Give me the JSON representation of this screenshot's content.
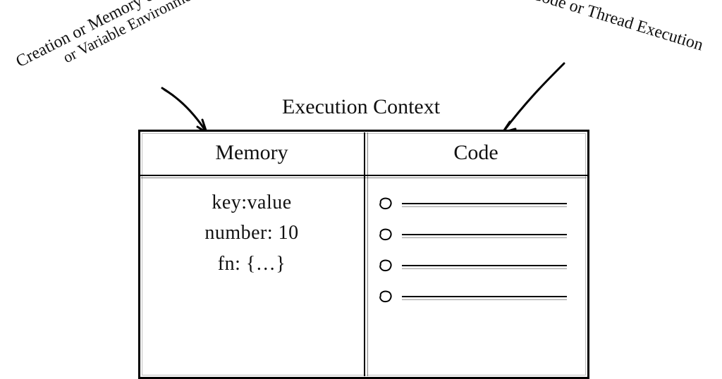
{
  "title": "Execution Context",
  "columns": {
    "memory_label": "Memory",
    "code_label": "Code"
  },
  "memory": {
    "line1": "key:value",
    "line2": "number: 10",
    "line3": "fn: {…}"
  },
  "code_row_count": 4,
  "annotations": {
    "left_line1": "Creation or Memory creation phase",
    "left_line2": "or Variable Environment",
    "right": "Code or Thread Execution"
  }
}
